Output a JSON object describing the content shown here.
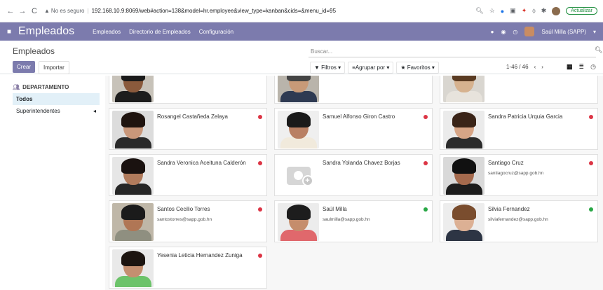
{
  "browser": {
    "insecure_label": "No es seguro",
    "url": "192.168.10.9:8069/web#action=138&model=hr.employee&view_type=kanban&cids=&menu_id=95",
    "update_label": "Actualizar"
  },
  "navbar": {
    "app_title": "Empleados",
    "menu": [
      "Empleados",
      "Directorio de Empleados",
      "Configuración"
    ],
    "user": "Saúl Milla (SAPP)"
  },
  "control_panel": {
    "breadcrumb": "Empleados",
    "create_label": "Crear",
    "import_label": "Importar",
    "search_placeholder": "Buscar...",
    "filters_label": "Filtros",
    "group_by_label": "Agrupar por",
    "favorites_label": "Favoritos",
    "pager": "1-46 / 46"
  },
  "sidebar": {
    "title": "DEPARTAMENTO",
    "items": [
      "Todos",
      "Superintendentes"
    ]
  },
  "employees": [
    {
      "name": "",
      "email": "",
      "status": "none",
      "skin": "#8a5a3c",
      "hair": "#1a1a1a",
      "shirt": "#1d1d1d",
      "bg": "#c7c2b9"
    },
    {
      "name": "",
      "email": "",
      "status": "none",
      "skin": "#c89a78",
      "hair": "#444",
      "shirt": "#2e3a52",
      "bg": "#b9b4ab"
    },
    {
      "name": "",
      "email": "",
      "status": "none",
      "skin": "#d6b28f",
      "hair": "#5a3b22",
      "shirt": "#e7e3dc",
      "bg": "#d9d6d0"
    },
    {
      "name": "Rosangel Castañeda Zelaya",
      "email": "",
      "status": "red",
      "skin": "#c9977a",
      "hair": "#1f140f",
      "shirt": "#2a2a2a",
      "bg": "#dcdcdc"
    },
    {
      "name": "Samuel Alfonso Giron Castro",
      "email": "",
      "status": "red",
      "skin": "#b98063",
      "hair": "#1a1a1a",
      "shirt": "#f1eadc",
      "bg": "#efefef"
    },
    {
      "name": "Sandra Patricia Urquia Garcia",
      "email": "",
      "status": "red",
      "skin": "#d7a586",
      "hair": "#3a2418",
      "shirt": "#2b2b2b",
      "bg": "#ebebeb"
    },
    {
      "name": "Sandra Veronica Aceituna Calderón",
      "email": "",
      "status": "red",
      "skin": "#b17b5c",
      "hair": "#1a1210",
      "shirt": "#262626",
      "bg": "#e6e6e6"
    },
    {
      "name": "Sandra Yolanda Chavez Borjas",
      "email": "",
      "status": "red",
      "skin": "",
      "hair": "",
      "shirt": "",
      "bg": ""
    },
    {
      "name": "Santiago Cruz",
      "email": "santiagocruz@sapp.gob.hn",
      "status": "red",
      "skin": "#a56a4d",
      "hair": "#111",
      "shirt": "#1c1c1c",
      "bg": "#d9d9d9"
    },
    {
      "name": "Santos Cecilio Torres",
      "email": "santostorres@sapp.gob.hn",
      "status": "red",
      "skin": "#b07655",
      "hair": "#1b1b1b",
      "shirt": "#8f8f80",
      "bg": "#bfb7a8"
    },
    {
      "name": "Saúl Milla",
      "email": "saulmilla@sapp.gob.hn",
      "status": "green",
      "skin": "#c58d6c",
      "hair": "#1d1d1d",
      "shirt": "#e0686c",
      "bg": "#ececec"
    },
    {
      "name": "Silvia Fernandez",
      "email": "silviafernandez@sapp.gob.hn",
      "status": "green",
      "skin": "#dcb094",
      "hair": "#7a4d2e",
      "shirt": "#2d3544",
      "bg": "#ededed"
    },
    {
      "name": "Yesenia Leticia Hernandez Zuniga",
      "email": "",
      "status": "red",
      "skin": "#c48f70",
      "hair": "#1c1410",
      "shirt": "#6cc36a",
      "bg": "#e9e9e9"
    }
  ]
}
